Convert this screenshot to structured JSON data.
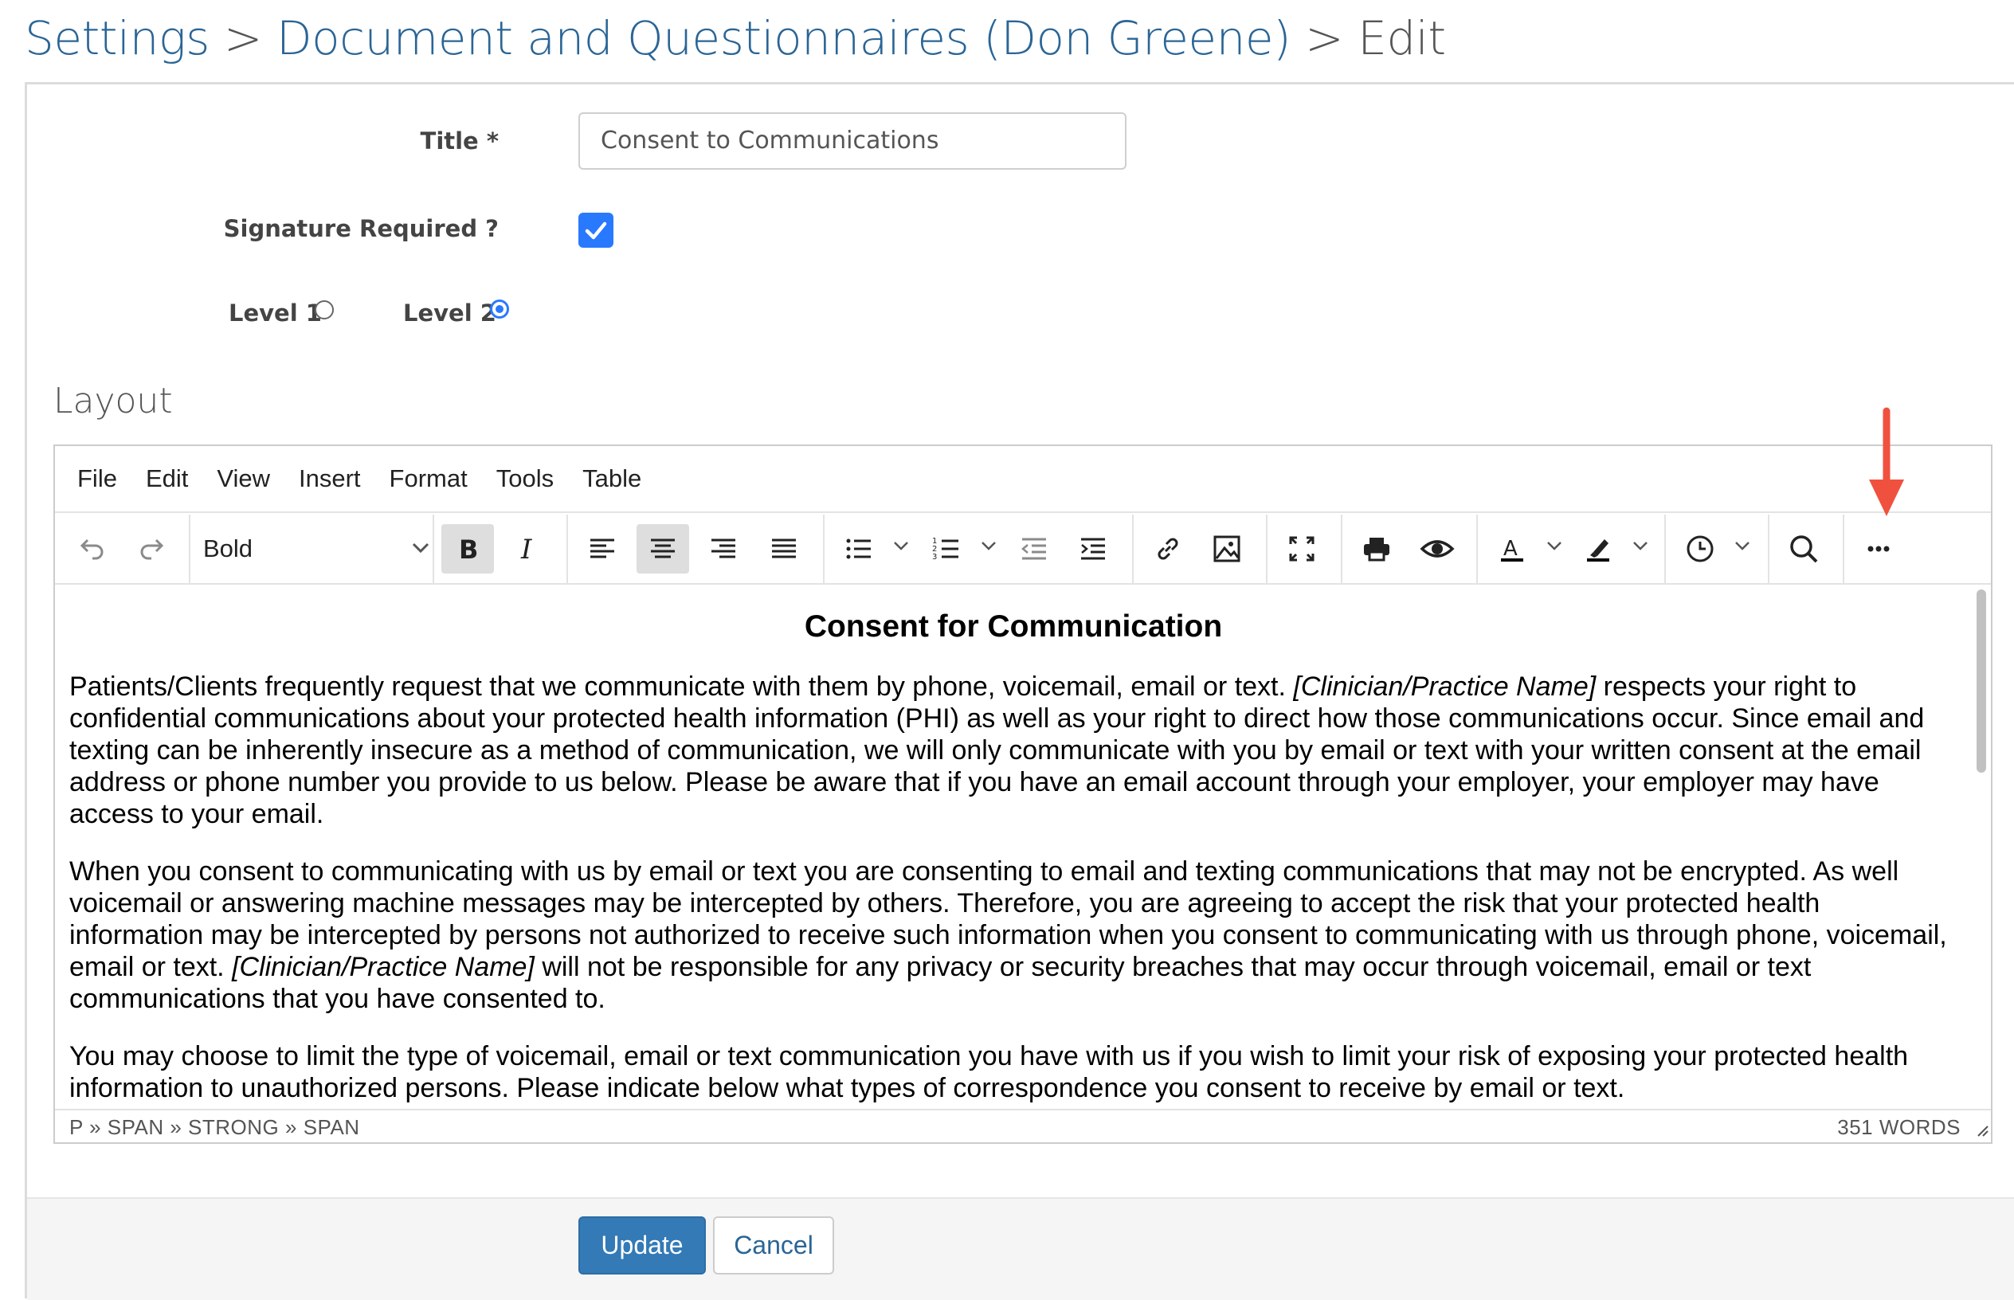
{
  "breadcrumb": {
    "settings": "Settings",
    "sep1": ">",
    "section": "Document and Questionnaires (Don Greene)",
    "sep2": ">",
    "current": "Edit"
  },
  "form": {
    "title_label": "Title *",
    "title_value": "Consent to Communications",
    "signature_label": "Signature Required ?",
    "signature_checked": true,
    "level1_label": "Level 1",
    "level2_label": "Level 2",
    "selected_level": "Level 2"
  },
  "layout": {
    "heading": "Layout"
  },
  "editor": {
    "menu": [
      "File",
      "Edit",
      "View",
      "Insert",
      "Format",
      "Tools",
      "Table"
    ],
    "block_format": "Bold",
    "toolbar_icons": [
      "undo-icon",
      "redo-icon",
      "bold-icon",
      "italic-icon",
      "align-left-icon",
      "align-center-icon",
      "align-right-icon",
      "align-justify-icon",
      "bullet-list-icon",
      "numbered-list-icon",
      "outdent-icon",
      "indent-icon",
      "link-icon",
      "image-icon",
      "fullscreen-icon",
      "print-icon",
      "preview-icon",
      "text-color-icon",
      "highlight-icon",
      "clock-icon",
      "search-icon",
      "more-icon"
    ],
    "document": {
      "heading": "Consent for Communication",
      "p1_a": "Patients/Clients frequently request that we communicate with them by phone, voicemail, email or text. ",
      "p1_ph": "[Clinician/Practice Name]",
      "p1_b": " respects your right to confidential communications about your protected health information (PHI) as well as your right to direct how those communications occur.   Since email and texting can be inherently insecure as a method of communication, we will only communicate with you by email or text with your written consent at the email address or phone number you provide to us below. Please be aware that if you have an email account through your employer, your employer may have access to your email.",
      "p2_a": "When you consent to communicating with us by email or text you are consenting to email and texting communications that may not be encrypted.  As well voicemail or answering machine messages may be intercepted by others. Therefore, you are agreeing to accept the risk that your protected health information may be intercepted by persons not authorized to receive such information when you consent to communicating with us through phone, voicemail, email or text. ",
      "p2_ph": "[Clinician/Practice Name]",
      "p2_b": " will not be responsible for any privacy or security breaches that may occur through voicemail, email or text communications that you have consented to.",
      "p3": "You may choose to limit the type of voicemail, email or text communication you have with us if you wish to limit your risk of exposing your protected health information to unauthorized persons. Please indicate below what types of correspondence you consent to receive by email or text."
    },
    "status_path": "P » SPAN » STRONG » SPAN",
    "word_count": "351 WORDS"
  },
  "buttons": {
    "update": "Update",
    "cancel": "Cancel"
  },
  "colors": {
    "link": "#2a6596",
    "primary": "#337ab7",
    "checkbox": "#2979ff",
    "annotation_arrow": "#f0513f"
  }
}
